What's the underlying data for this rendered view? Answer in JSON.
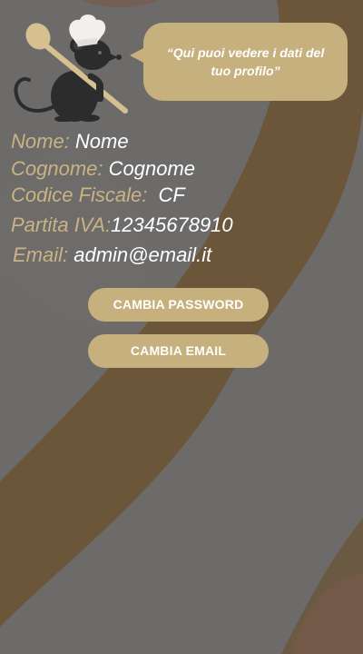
{
  "bubble": {
    "text": "“Qui puoi vedere i dati del tuo profilo”"
  },
  "profile": {
    "fields": [
      {
        "label": "Nome:",
        "value": "Nome"
      },
      {
        "label": "Cognome:",
        "value": "Cognome"
      },
      {
        "label": "Codice Fiscale:",
        "value": "CF"
      },
      {
        "label": "Partita IVA:",
        "value": "12345678910"
      },
      {
        "label": "Email:",
        "value": "admin@email.it"
      }
    ]
  },
  "actions": {
    "change_password": "CAMBIA PASSWORD",
    "change_email": "CAMBIA EMAIL"
  },
  "colors": {
    "accent": "#c6b07e",
    "background": "#6c6b6a",
    "stripe_brown": "#6b5639"
  },
  "icons": {
    "mascot": "chef-rat-with-spoon-icon"
  }
}
